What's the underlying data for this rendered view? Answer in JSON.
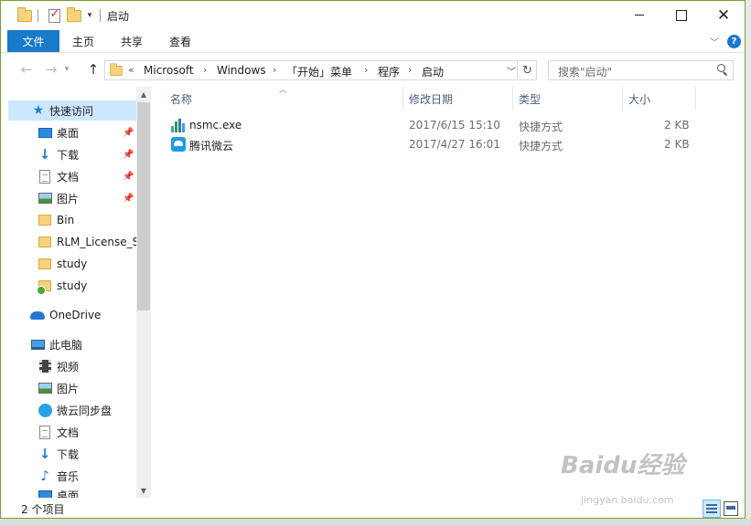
{
  "window": {
    "title": "启动"
  },
  "ribbon": {
    "tabs": [
      "文件",
      "主页",
      "共享",
      "查看"
    ]
  },
  "address": {
    "prefix": "«",
    "crumbs": [
      "Microsoft",
      "Windows",
      "「开始」菜单",
      "程序",
      "启动"
    ]
  },
  "search": {
    "placeholder": "搜索\"启动\""
  },
  "navigation": {
    "items": [
      {
        "label": "快速访问",
        "icon": "star-icon",
        "pinned": false
      },
      {
        "label": "桌面",
        "icon": "desktop-icon",
        "pinned": true
      },
      {
        "label": "下载",
        "icon": "download-icon",
        "pinned": true
      },
      {
        "label": "文档",
        "icon": "document-icon",
        "pinned": true
      },
      {
        "label": "图片",
        "icon": "picture-icon",
        "pinned": true
      },
      {
        "label": "Bin",
        "icon": "folder-icon",
        "pinned": false
      },
      {
        "label": "RLM_License_S",
        "icon": "folder-icon",
        "pinned": false
      },
      {
        "label": "study",
        "icon": "folder-icon",
        "pinned": false
      },
      {
        "label": "study",
        "icon": "folder-sync-icon",
        "pinned": false
      },
      {
        "label": "OneDrive",
        "icon": "onedrive-icon",
        "pinned": false
      },
      {
        "label": "此电脑",
        "icon": "this-pc-icon",
        "pinned": false
      },
      {
        "label": "视频",
        "icon": "video-icon",
        "pinned": false
      },
      {
        "label": "图片",
        "icon": "picture-icon",
        "pinned": false
      },
      {
        "label": "微云同步盘",
        "icon": "weiyun-icon",
        "pinned": false
      },
      {
        "label": "文档",
        "icon": "document-icon",
        "pinned": false
      },
      {
        "label": "下载",
        "icon": "download-icon",
        "pinned": false
      },
      {
        "label": "音乐",
        "icon": "music-icon",
        "pinned": false
      },
      {
        "label": "桌面",
        "icon": "desktop-icon",
        "pinned": false
      }
    ]
  },
  "columns": {
    "name": "名称",
    "date": "修改日期",
    "type": "类型",
    "size": "大小"
  },
  "files": [
    {
      "name": "nsmc.exe",
      "date": "2017/6/15 15:10",
      "type": "快捷方式",
      "size": "2 KB",
      "icon": "nsmc-app-icon"
    },
    {
      "name": "腾讯微云",
      "date": "2017/4/27 16:01",
      "type": "快捷方式",
      "size": "2 KB",
      "icon": "tencent-weiyun-icon"
    }
  ],
  "status": {
    "count_text": "2 个项目"
  },
  "watermark": {
    "text": "Baidu经验",
    "sub": "jingyan.baidu.com"
  },
  "colors": {
    "accent": "#1979ca",
    "selection": "#cce8ff",
    "folder": "#f6d27a"
  }
}
